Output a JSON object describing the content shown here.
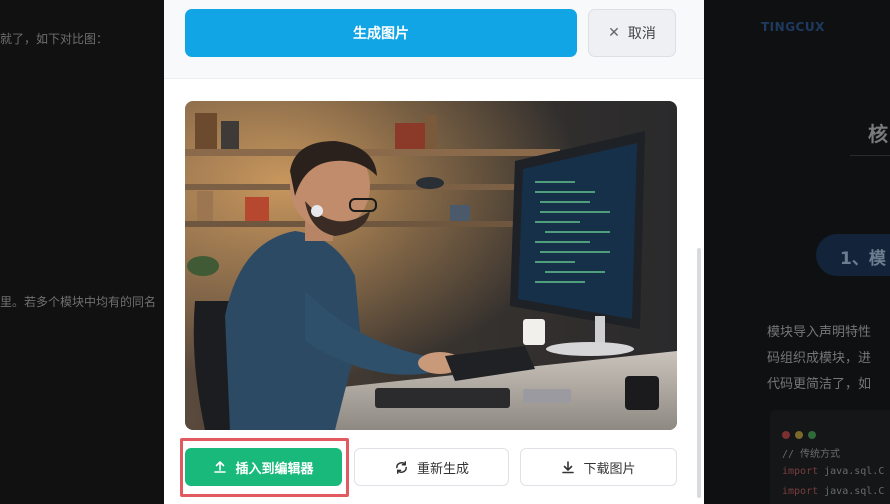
{
  "background_left": {
    "line1": "就了，如下对比图：",
    "line2": "里。若多个模块中均有的同名"
  },
  "background_right": {
    "logo": "TINGCUX",
    "heading": "核",
    "section_pill": "1、模",
    "paragraph": [
      "模块导入声明特性",
      "码组织成模块，进",
      "代码更简洁了，如"
    ],
    "code_comment": "// 传统方式",
    "code_lines": [
      {
        "keyword": "import",
        "rest": " java.sql.C"
      },
      {
        "keyword": "import",
        "rest": " java.sql.C"
      }
    ]
  },
  "modal": {
    "generate_label": "生成图片",
    "cancel_label": "取消",
    "insert_label": "插入到编辑器",
    "regenerate_label": "重新生成",
    "download_label": "下载图片"
  },
  "icons": {
    "cancel": "close-icon",
    "insert": "upload-icon",
    "regenerate": "refresh-icon",
    "download": "download-icon"
  },
  "colors": {
    "primary_blue": "#12a5e6",
    "success_green": "#18b97b",
    "highlight_red": "#e15a5f"
  }
}
